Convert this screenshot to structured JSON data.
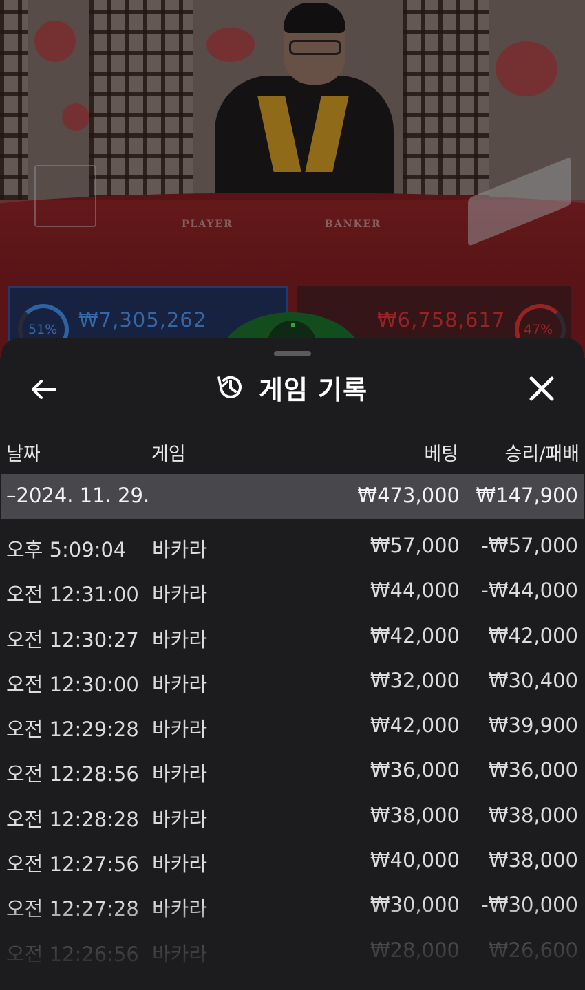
{
  "video": {
    "table_labels": {
      "player": "PLAYER",
      "banker": "BANKER"
    },
    "player": {
      "percent": "51%",
      "amount": "₩7,305,262"
    },
    "banker": {
      "percent": "47%",
      "amount": "₩6,758,617"
    },
    "colors": {
      "player": "#4a8fe8",
      "banker": "#d33131",
      "table": "#7d1d20"
    }
  },
  "sheet": {
    "title": "게임 기록",
    "icons": {
      "back": "arrow-left-icon",
      "title": "history-icon",
      "close": "close-icon"
    },
    "columns": {
      "date": "날짜",
      "game": "게임",
      "bet": "베팅",
      "result": "승리/패배"
    },
    "group": {
      "label": "–2024. 11. 29.",
      "bet": "₩473,000",
      "result": "₩147,900"
    },
    "rows": [
      {
        "time": "오후 5:09:04",
        "game": "바카라",
        "bet": "₩57,000",
        "result": "-₩57,000"
      },
      {
        "time": "오전 12:31:00",
        "game": "바카라",
        "bet": "₩44,000",
        "result": "-₩44,000"
      },
      {
        "time": "오전 12:30:27",
        "game": "바카라",
        "bet": "₩42,000",
        "result": "₩42,000"
      },
      {
        "time": "오전 12:30:00",
        "game": "바카라",
        "bet": "₩32,000",
        "result": "₩30,400"
      },
      {
        "time": "오전 12:29:28",
        "game": "바카라",
        "bet": "₩42,000",
        "result": "₩39,900"
      },
      {
        "time": "오전 12:28:56",
        "game": "바카라",
        "bet": "₩36,000",
        "result": "₩36,000"
      },
      {
        "time": "오전 12:28:28",
        "game": "바카라",
        "bet": "₩38,000",
        "result": "₩38,000"
      },
      {
        "time": "오전 12:27:56",
        "game": "바카라",
        "bet": "₩40,000",
        "result": "₩38,000"
      },
      {
        "time": "오전 12:27:28",
        "game": "바카라",
        "bet": "₩30,000",
        "result": "-₩30,000"
      },
      {
        "time": "오전 12:26:56",
        "game": "바카라",
        "bet": "₩28,000",
        "result": "₩26,600"
      }
    ]
  }
}
